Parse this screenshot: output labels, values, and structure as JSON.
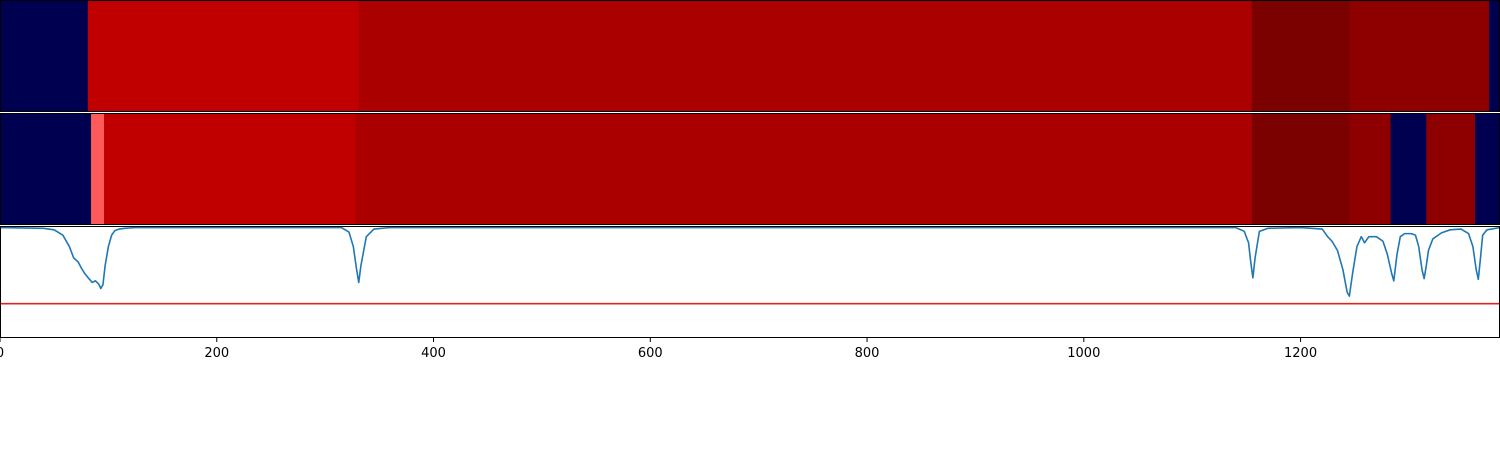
{
  "chart_data": [
    {
      "type": "heatmap",
      "title": "",
      "xlim": [
        0,
        1384
      ],
      "colors": {
        "low": "#000050",
        "bright": "#ff5a5a",
        "red": "#c00000",
        "mid": "#aa0000",
        "deep": "#7b0000",
        "dark": "#8e0000"
      },
      "segments": [
        {
          "x0": 0,
          "x1": 81,
          "level": "low"
        },
        {
          "x0": 81,
          "x1": 331,
          "level": "red"
        },
        {
          "x0": 331,
          "x1": 1155,
          "level": "mid"
        },
        {
          "x0": 1155,
          "x1": 1245,
          "level": "deep"
        },
        {
          "x0": 1245,
          "x1": 1374,
          "level": "dark"
        },
        {
          "x0": 1374,
          "x1": 1384,
          "level": "low"
        }
      ]
    },
    {
      "type": "heatmap",
      "title": "",
      "xlim": [
        0,
        1384
      ],
      "segments": [
        {
          "x0": 0,
          "x1": 84,
          "level": "low"
        },
        {
          "x0": 84,
          "x1": 96,
          "level": "bright"
        },
        {
          "x0": 96,
          "x1": 328,
          "level": "red"
        },
        {
          "x0": 328,
          "x1": 1155,
          "level": "mid"
        },
        {
          "x0": 1155,
          "x1": 1245,
          "level": "deep"
        },
        {
          "x0": 1245,
          "x1": 1283,
          "level": "dark"
        },
        {
          "x0": 1283,
          "x1": 1316,
          "level": "low"
        },
        {
          "x0": 1316,
          "x1": 1361,
          "level": "dark"
        },
        {
          "x0": 1361,
          "x1": 1384,
          "level": "low"
        }
      ]
    },
    {
      "type": "line",
      "title": "",
      "xlabel": "",
      "ylabel": "",
      "xlim": [
        0,
        1384
      ],
      "ylim": [
        -1.45,
        0.02
      ],
      "xticks": [
        0,
        200,
        400,
        600,
        800,
        1000,
        1200
      ],
      "threshold": {
        "y": -1.0,
        "color": "#e8201e"
      },
      "series": [
        {
          "color": "#1f77b4",
          "x": [
            0,
            40,
            50,
            58,
            64,
            68,
            72,
            75,
            78,
            82,
            85,
            88,
            91,
            93,
            95,
            97,
            100,
            103,
            106,
            110,
            115,
            125,
            200,
            315,
            322,
            326,
            329,
            331,
            333,
            338,
            345,
            360,
            1140,
            1148,
            1152,
            1154,
            1156,
            1158,
            1162,
            1170,
            1200,
            1220,
            1225,
            1229,
            1234,
            1239,
            1243,
            1245,
            1248,
            1252,
            1256,
            1259,
            1263,
            1270,
            1276,
            1280,
            1284,
            1286,
            1289,
            1292,
            1296,
            1302,
            1306,
            1309,
            1312,
            1314,
            1316,
            1318,
            1322,
            1330,
            1338,
            1348,
            1355,
            1359,
            1362,
            1364,
            1366,
            1368,
            1372,
            1380,
            1384
          ],
          "y": [
            0,
            -0.01,
            -0.03,
            -0.1,
            -0.25,
            -0.4,
            -0.45,
            -0.53,
            -0.6,
            -0.67,
            -0.72,
            -0.7,
            -0.74,
            -0.8,
            -0.75,
            -0.5,
            -0.25,
            -0.1,
            -0.04,
            -0.02,
            -0.01,
            0,
            0,
            0,
            -0.06,
            -0.25,
            -0.55,
            -0.72,
            -0.5,
            -0.12,
            -0.02,
            0,
            0,
            -0.05,
            -0.2,
            -0.45,
            -0.66,
            -0.4,
            -0.05,
            -0.01,
            0,
            -0.02,
            -0.12,
            -0.18,
            -0.3,
            -0.55,
            -0.85,
            -0.9,
            -0.6,
            -0.25,
            -0.12,
            -0.2,
            -0.12,
            -0.12,
            -0.18,
            -0.35,
            -0.6,
            -0.7,
            -0.35,
            -0.12,
            -0.08,
            -0.08,
            -0.1,
            -0.25,
            -0.55,
            -0.67,
            -0.5,
            -0.3,
            -0.15,
            -0.07,
            -0.03,
            -0.02,
            -0.08,
            -0.25,
            -0.55,
            -0.68,
            -0.4,
            -0.1,
            -0.03,
            -0.01,
            0
          ]
        }
      ]
    }
  ]
}
